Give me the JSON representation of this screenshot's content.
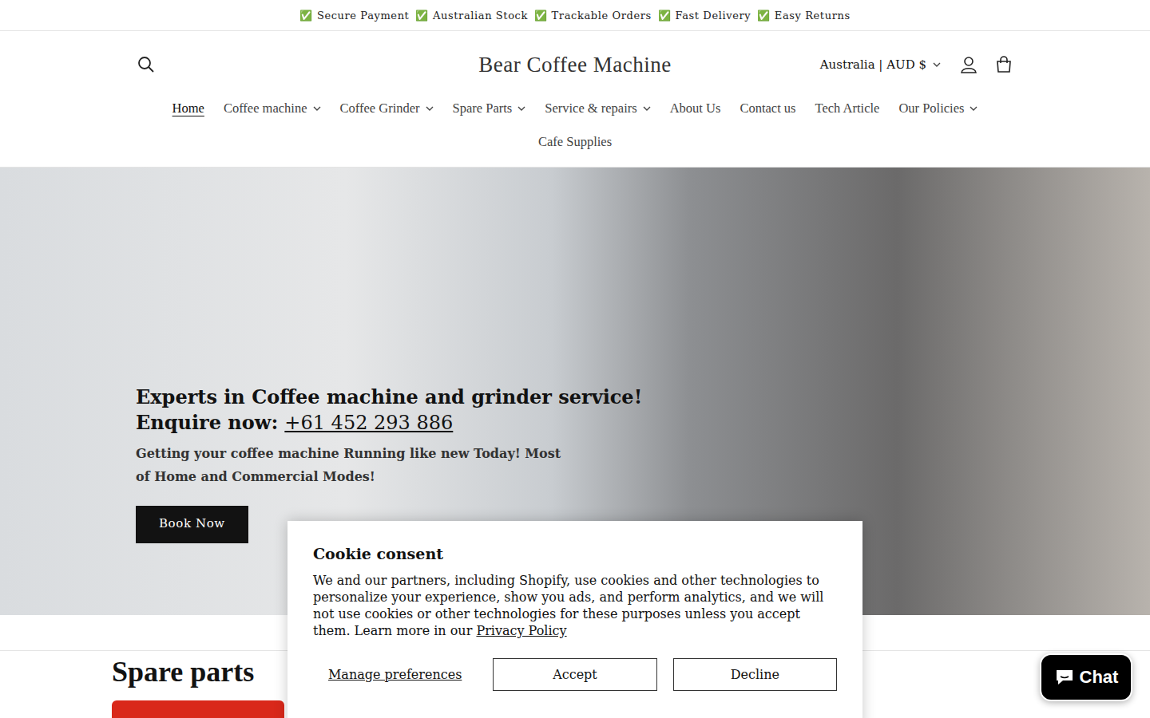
{
  "announcement": [
    {
      "icon": "✅",
      "text": "Secure Payment"
    },
    {
      "icon": "✅",
      "text": "Australian Stock"
    },
    {
      "icon": "✅",
      "text": "Trackable Orders"
    },
    {
      "icon": "✅",
      "text": "Fast Delivery"
    },
    {
      "icon": "✅",
      "text": "Easy Returns"
    }
  ],
  "header": {
    "logo": "Bear Coffee Machine",
    "country": "Australia | AUD $"
  },
  "nav": [
    {
      "label": "Home",
      "selected": true,
      "dropdown": false
    },
    {
      "label": "Coffee machine",
      "selected": false,
      "dropdown": true
    },
    {
      "label": "Coffee Grinder",
      "selected": false,
      "dropdown": true
    },
    {
      "label": "Spare Parts",
      "selected": false,
      "dropdown": true
    },
    {
      "label": "Service & repairs",
      "selected": false,
      "dropdown": true
    },
    {
      "label": "About Us",
      "selected": false,
      "dropdown": false
    },
    {
      "label": "Contact us",
      "selected": false,
      "dropdown": false
    },
    {
      "label": "Tech Article",
      "selected": false,
      "dropdown": false
    },
    {
      "label": "Our Policies",
      "selected": false,
      "dropdown": true
    },
    {
      "label": "Cafe Supplies",
      "selected": false,
      "dropdown": false
    }
  ],
  "hero": {
    "title": "Experts in Coffee machine and grinder service!",
    "enquire_label": "Enquire now:",
    "phone": "+61 452 293 886",
    "subtitle": "Getting your coffee machine Running like new Today! Most of Home and Commercial Modes!",
    "button": "Book Now"
  },
  "section": {
    "title": "Spare parts"
  },
  "cookie": {
    "title": "Cookie consent",
    "text": "We and our partners, including Shopify, use cookies and other technologies to personalize your experience, show you ads, and perform analytics, and we will not use cookies or other technologies for these purposes unless you accept them. Learn more in our",
    "link": "Privacy Policy",
    "buttons": [
      "Manage preferences",
      "Accept",
      "Decline"
    ]
  },
  "chat": {
    "label": "Chat"
  }
}
